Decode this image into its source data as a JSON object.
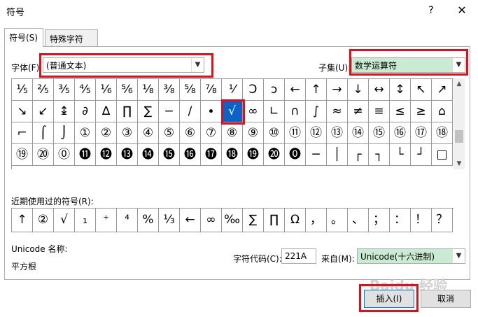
{
  "window": {
    "title": "符号",
    "help_glyph": "?",
    "close_glyph": "✕"
  },
  "tabs": [
    {
      "label": "符号(S)",
      "active": true
    },
    {
      "label": "特殊字符(P)",
      "active": false
    }
  ],
  "font": {
    "label": "字体(F):",
    "value": "(普通文本)"
  },
  "subset": {
    "label": "子集(U):",
    "value": "数学运算符"
  },
  "symbols": [
    "⅕",
    "⅖",
    "⅗",
    "⅘",
    "⅙",
    "⅚",
    "⅛",
    "⅜",
    "⅝",
    "⅞",
    "⅟",
    "Ↄ",
    "ↄ",
    "←",
    "↑",
    "→",
    "↓",
    "↔",
    "↕",
    "↖",
    "↗",
    "↘",
    "↙",
    "↨",
    "∂",
    "∆",
    "∏",
    "∑",
    "−",
    "∕",
    "∙",
    "√",
    "∞",
    "∟",
    "∩",
    "∫",
    "≈",
    "≠",
    "≡",
    "≤",
    "≥",
    "⌂",
    "⌐",
    "⌠",
    "⌡",
    "①",
    "②",
    "③",
    "④",
    "⑤",
    "⑥",
    "⑦",
    "⑧",
    "⑨",
    "⑩",
    "⑪",
    "⑫",
    "⑬",
    "⑭",
    "⑮",
    "⑯",
    "⑰",
    "⑱",
    "⑲",
    "⑳",
    "⓪",
    "⓫",
    "⓬",
    "⓭",
    "⓮",
    "⓯",
    "⓰",
    "⓱",
    "⓲",
    "⓳",
    "⓴",
    "⓿",
    "─",
    "│",
    "┌",
    "┐",
    "└",
    "┘",
    "□"
  ],
  "selected_symbol": "√",
  "recent": {
    "label": "近期使用过的符号(R):",
    "symbols": [
      "↑",
      "②",
      "√",
      "₁",
      "⁺",
      "⁴",
      "%",
      "⅓",
      "←",
      "∞",
      "‰",
      "∑",
      "∏",
      "Ω",
      "，",
      "。",
      "、",
      "；",
      "：",
      "！",
      "？"
    ]
  },
  "unicode_name": {
    "label": "Unicode 名称:",
    "value": "平方根"
  },
  "char_code": {
    "label": "字符代码(C):",
    "value": "221A"
  },
  "from": {
    "label": "来自(M):",
    "value": "Unicode(十六进制)"
  },
  "buttons": {
    "insert": "插入(I)",
    "cancel": "取消"
  },
  "watermark": "Baidu 经验",
  "colors": {
    "highlight": "#e0101a",
    "selection": "#0a64c8",
    "subset_bg": "#c9ebd1"
  }
}
